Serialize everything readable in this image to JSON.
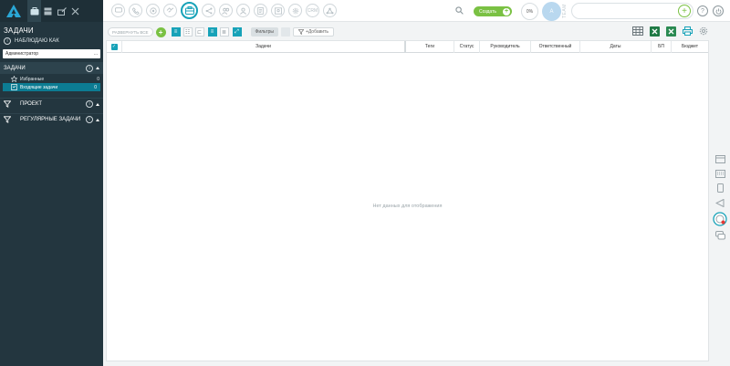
{
  "sidebar": {
    "title": "ЗАДАЧИ",
    "observe_label": "НАБЛЮДАЮ КАК",
    "user_select": "Администратор",
    "user_select_more": "...",
    "section_tasks": "ЗАДАЧИ",
    "items": [
      {
        "label": "Избранные",
        "count": "0"
      },
      {
        "label": "Входящие задачи",
        "count": "0"
      }
    ],
    "group_project": "ПРОЕКТ",
    "group_regular": "РЕГУЛЯРНЫЕ ЗАДАЧИ"
  },
  "topbar": {
    "create_label": "Создать",
    "progress": "0%",
    "avatar_initial": "A",
    "team_label": "TEAM",
    "crm_label": "CRM"
  },
  "toolbar": {
    "expand_all": "РАЗВЕРНУТЬ ВСЕ",
    "filters": "Фильтры",
    "add_filter": "+Добавить"
  },
  "table": {
    "columns": [
      "Задачи",
      "Теги",
      "Статус",
      "Руководитель",
      "Ответственный",
      "Даты",
      "БП",
      "Бюджет"
    ],
    "empty_text": "Нет данных для отображения"
  },
  "colors": {
    "sidebar_bg": "#23363f",
    "accent": "#17a2b8",
    "active_item": "#0c7c93",
    "create_green": "#7ac143"
  }
}
